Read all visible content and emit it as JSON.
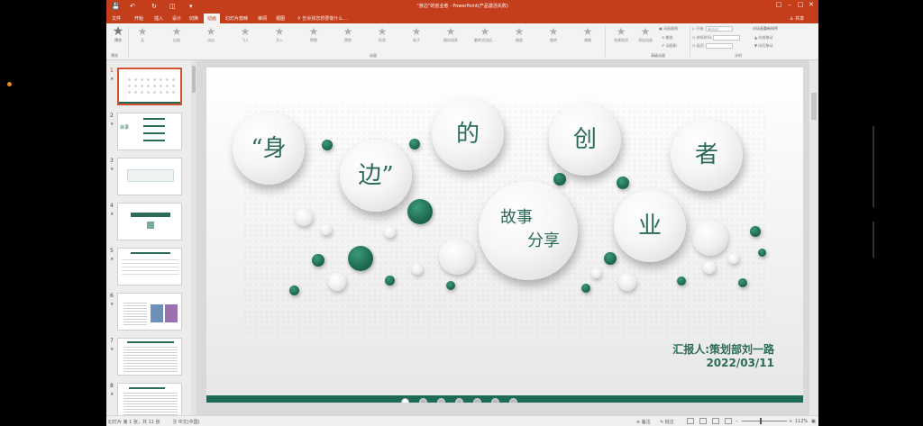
{
  "window": {
    "title": "“身边”的创业者 - PowerPoint(产品激活失败)",
    "quick_access": [
      "save-icon",
      "undo-icon",
      "redo-icon",
      "present-icon",
      "more-icon"
    ]
  },
  "tabs": [
    {
      "label": "文件"
    },
    {
      "label": "开始"
    },
    {
      "label": "插入"
    },
    {
      "label": "设计"
    },
    {
      "label": "切换"
    },
    {
      "label": "动画",
      "active": true
    },
    {
      "label": "幻灯片放映"
    },
    {
      "label": "审阅"
    },
    {
      "label": "视图"
    }
  ],
  "tell_me": "告诉我您想要做什么...",
  "share": "共享",
  "ribbon": {
    "preview_label": "预览",
    "preview_group": "预览",
    "animations": [
      "无",
      "出现",
      "淡出",
      "飞入",
      "浮入",
      "劈裂",
      "擦除",
      "形状",
      "轮子",
      "随机线条",
      "翻转式由远...",
      "缩放",
      "旋转",
      "弹跳"
    ],
    "animation_group": "动画",
    "effect_options": "效果选项",
    "add_animation": "添加动画",
    "advanced_group": "高级动画",
    "animation_pane": "动画窗格",
    "trigger": "触发",
    "painter": "动画刷",
    "start_label": "开始:",
    "start_value": "单击时",
    "duration_label": "持续时间:",
    "delay_label": "延迟:",
    "reorder_title": "对动画重新排序",
    "move_earlier": "向前移动",
    "move_later": "向后移动",
    "timing_group": "计时"
  },
  "slides_panel": {
    "slides": [
      {
        "num": "1",
        "selected": true
      },
      {
        "num": "2",
        "text": "目录"
      },
      {
        "num": "3"
      },
      {
        "num": "4"
      },
      {
        "num": "5"
      },
      {
        "num": "6"
      },
      {
        "num": "7"
      },
      {
        "num": "8"
      }
    ]
  },
  "slide": {
    "bubbles": [
      "“身",
      "边”",
      "的",
      "创",
      "者",
      "故事",
      "分享",
      "业"
    ],
    "reporter": "汇报人:策划部刘一路",
    "date": "2022/03/11"
  },
  "status": {
    "slide_info": "幻灯片 第 1 张，共 11 张",
    "language": "中文(中国)",
    "notes": "备注",
    "comments": "批注",
    "zoom": "112%"
  },
  "colors": {
    "brand": "#c43e1c",
    "accent_green": "#2b6b57"
  }
}
